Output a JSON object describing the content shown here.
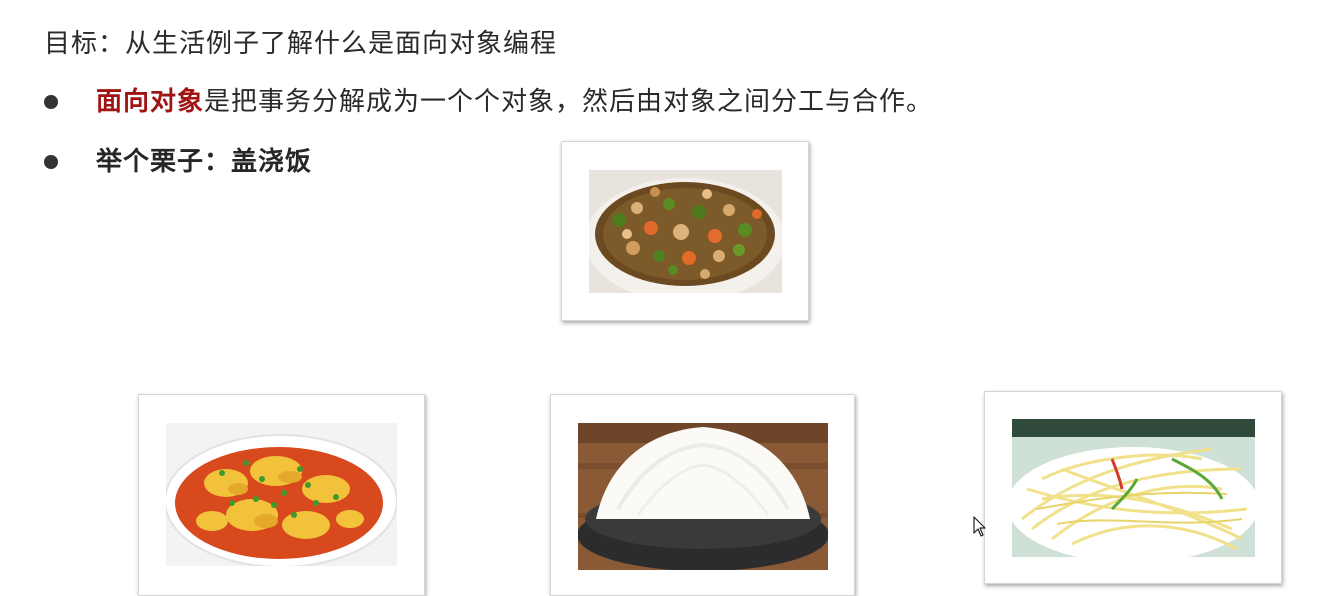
{
  "slide": {
    "title": "目标：从生活例子了解什么是面向对象编程",
    "bullets": [
      {
        "emphasis": "面向对象",
        "text": "是把事务分解成为一个个对象，然后由对象之间分工与合作。"
      },
      {
        "text": "举个栗子：盖浇饭"
      }
    ]
  },
  "images": [
    {
      "name": "kung-pao-dish-photo",
      "subject": "diced chicken with peanuts and edamame"
    },
    {
      "name": "tomato-egg-photo",
      "subject": "scrambled eggs with tomato"
    },
    {
      "name": "rice-bowl-photo",
      "subject": "bowl of white rice"
    },
    {
      "name": "shredded-potato-photo",
      "subject": "stir-fried shredded potato"
    }
  ],
  "colors": {
    "accent": "#a01414",
    "text": "#2a2a2a"
  }
}
